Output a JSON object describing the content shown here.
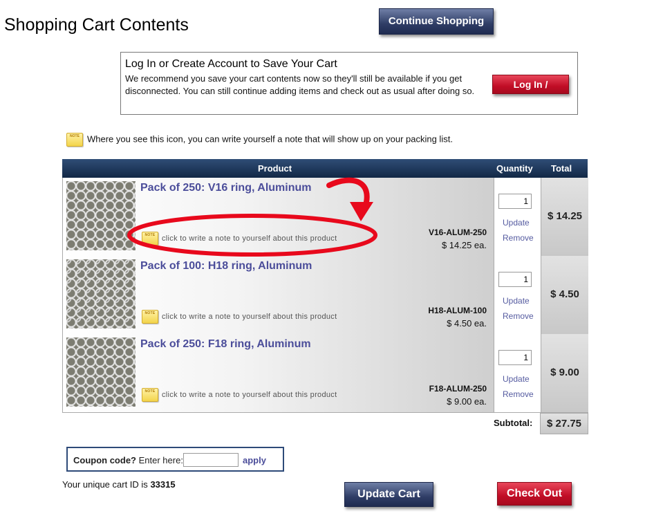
{
  "page_title": "Shopping Cart Contents",
  "continue_label": "Continue Shopping",
  "login": {
    "title": "Log In or Create Account to Save Your Cart",
    "text": "We recommend you save your cart contents now so they'll still be available if you get disconnected. You can still continue adding items and check out as usual after doing so.",
    "button": "Log In / Register"
  },
  "note_hint": "Where you see this icon, you can write yourself a note that will show up on your packing list.",
  "note_icon_text": "NOTE",
  "table": {
    "col_product": "Product",
    "col_quantity": "Quantity",
    "col_total": "Total"
  },
  "items": [
    {
      "name": "Pack of 250: V16 ring, Aluminum",
      "note": "click to write a note to yourself about this product",
      "sku": "V16-ALUM-250",
      "each": "$ 14.25 ea.",
      "qty": "1",
      "update": "Update",
      "remove": "Remove",
      "total": "$ 14.25"
    },
    {
      "name": "Pack of 100: H18 ring, Aluminum",
      "note": "click to write a note to yourself about this product",
      "sku": "H18-ALUM-100",
      "each": "$ 4.50 ea.",
      "qty": "1",
      "update": "Update",
      "remove": "Remove",
      "total": "$ 4.50"
    },
    {
      "name": "Pack of 250: F18 ring, Aluminum",
      "note": "click to write a note to yourself about this product",
      "sku": "F18-ALUM-250",
      "each": "$ 9.00 ea.",
      "qty": "1",
      "update": "Update",
      "remove": "Remove",
      "total": "$ 9.00"
    }
  ],
  "subtotal_label": "Subtotal:",
  "subtotal_value": "$ 27.75",
  "coupon": {
    "label_bold": "Coupon code?",
    "label_rest": " Enter here:",
    "apply": "apply"
  },
  "cart_id": {
    "prefix": "Your unique cart ID is ",
    "value": "33315"
  },
  "update_cart_label": "Update Cart",
  "checkout_label": "Check Out",
  "colors": {
    "navy": "#1f2b50",
    "red": "#c10d26",
    "link_purple": "#4b4d9a",
    "annotation_red": "#e8091c"
  }
}
